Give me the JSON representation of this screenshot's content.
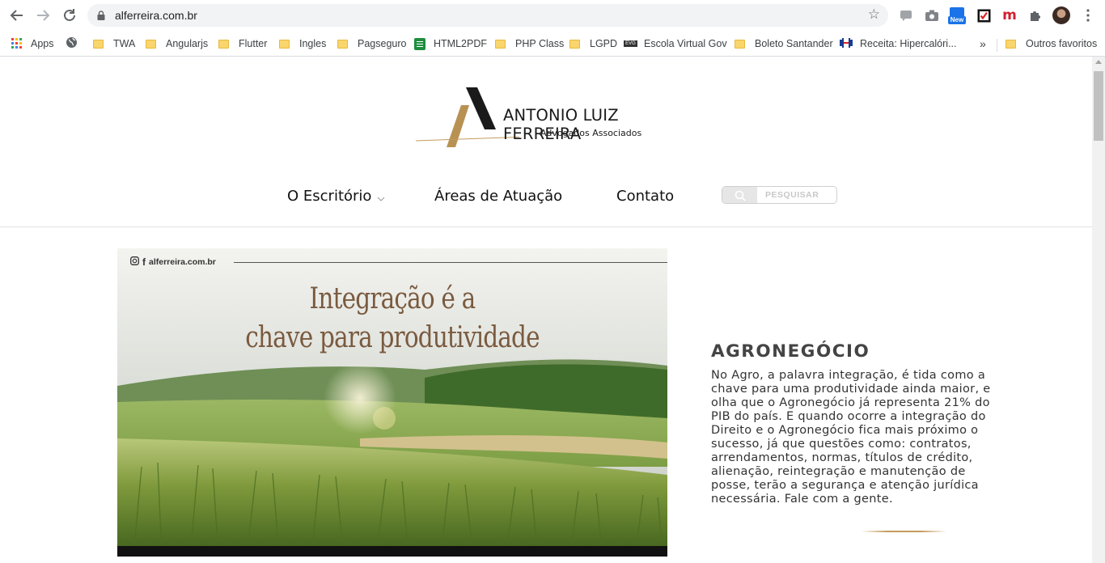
{
  "browser": {
    "url": "alferreira.com.br",
    "bookmarks": [
      {
        "label": "Apps",
        "icon": "apps-grid-icon"
      },
      {
        "label": "",
        "icon": "globe-icon"
      },
      {
        "label": "TWA",
        "icon": "folder-icon"
      },
      {
        "label": "Angularjs",
        "icon": "folder-icon"
      },
      {
        "label": "Flutter",
        "icon": "folder-icon"
      },
      {
        "label": "Ingles",
        "icon": "folder-icon"
      },
      {
        "label": "Pagseguro",
        "icon": "folder-icon"
      },
      {
        "label": "HTML2PDF",
        "icon": "doc-icon"
      },
      {
        "label": "PHP Class",
        "icon": "folder-icon"
      },
      {
        "label": "LGPD",
        "icon": "folder-icon"
      },
      {
        "label": "Escola Virtual Gov",
        "icon": "gov-icon"
      },
      {
        "label": "Boleto Santander",
        "icon": "folder-icon"
      },
      {
        "label": "Receita: Hipercalóri...",
        "icon": "dumbbell-icon"
      }
    ],
    "more_label": "»",
    "other_favorites": "Outros favoritos",
    "new_badge": "New",
    "ext_m": "m"
  },
  "site": {
    "logo_title": "ANTONIO LUIZ FERREIRA",
    "logo_subtitle": "Advogados Associados",
    "nav": {
      "escritorio": "O Escritório",
      "areas": "Áreas de Atuação",
      "contato": "Contato"
    },
    "search_placeholder": "PESQUISAR",
    "hero": {
      "social": "alferreira.com.br",
      "headline_line1": "Integração é a",
      "headline_line2": "chave para produtividade"
    },
    "section": {
      "title": "AGRONEGÓCIO",
      "text": "No Agro, a palavra integração, é tida como a chave para uma produtividade ainda maior, e olha que o Agronegócio já representa 21% do PIB do país. E quando ocorre a integração do Direito e o Agronegócio fica mais próximo o sucesso, já que questões como: contratos, arrendamentos, normas, títulos de crédito, alienação, reintegração e manutenção de posse, terão a segurança e atenção jurídica necessária. Fale com a gente."
    }
  },
  "colors": {
    "gold": "#c49b5e",
    "brown_text": "#7a5a3f",
    "dark": "#1a1a1a"
  }
}
